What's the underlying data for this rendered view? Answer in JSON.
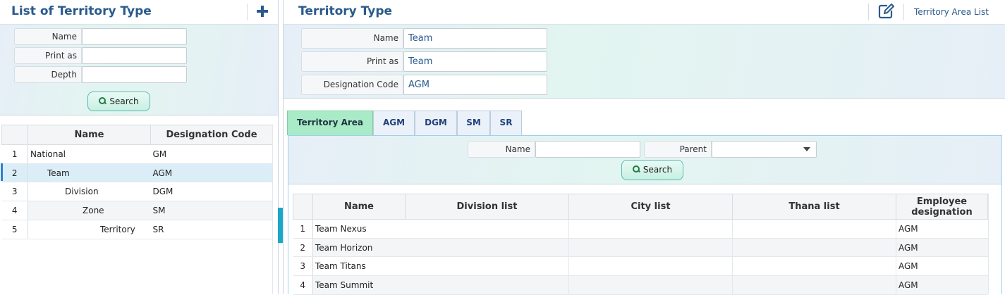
{
  "left": {
    "title": "List of Territory Type",
    "filters": {
      "name_label": "Name",
      "name_value": "",
      "print_as_label": "Print as",
      "print_as_value": "",
      "depth_label": "Depth",
      "depth_value": ""
    },
    "search_label": "Search",
    "table": {
      "columns": [
        "Name",
        "Designation Code"
      ],
      "rows": [
        {
          "num": "1",
          "name": "National",
          "code": "GM"
        },
        {
          "num": "2",
          "name": "Team",
          "code": "AGM"
        },
        {
          "num": "3",
          "name": "Division",
          "code": "DGM"
        },
        {
          "num": "4",
          "name": "Zone",
          "code": "SM"
        },
        {
          "num": "5",
          "name": "Territory",
          "code": "SR"
        }
      ],
      "selected_row": 2
    }
  },
  "right": {
    "title": "Territory Type",
    "area_list_link": "Territory Area List",
    "details": {
      "name_label": "Name",
      "name_value": "Team",
      "print_as_label": "Print as",
      "print_as_value": "Team",
      "designation_code_label": "Designation Code",
      "designation_code_value": "AGM"
    },
    "tabs": [
      "Territory Area",
      "AGM",
      "DGM",
      "SM",
      "SR"
    ],
    "active_tab": "Territory Area",
    "tab_filter": {
      "name_label": "Name",
      "name_value": "",
      "parent_label": "Parent",
      "parent_value": ""
    },
    "search_label": "Search",
    "table": {
      "columns": [
        "Name",
        "Division list",
        "City list",
        "Thana list",
        "Employee designation"
      ],
      "rows": [
        {
          "num": "1",
          "name": "Team Nexus",
          "division": "",
          "city": "",
          "thana": "",
          "designation": "AGM"
        },
        {
          "num": "2",
          "name": "Team Horizon",
          "division": "",
          "city": "",
          "thana": "",
          "designation": "AGM"
        },
        {
          "num": "3",
          "name": "Team Titans",
          "division": "",
          "city": "",
          "thana": "",
          "designation": "AGM"
        },
        {
          "num": "4",
          "name": "Team Summit",
          "division": "",
          "city": "",
          "thana": "",
          "designation": "AGM"
        }
      ]
    }
  },
  "icons": {
    "plus": "plus-icon",
    "edit": "edit-icon",
    "search": "search-icon",
    "dropdown": "chevron-down-icon"
  },
  "colors": {
    "title": "#2a5a8c",
    "active_tab": "#a9ebc6",
    "selected_row": "#dbeef8",
    "splitter": "#1aa7c8"
  }
}
